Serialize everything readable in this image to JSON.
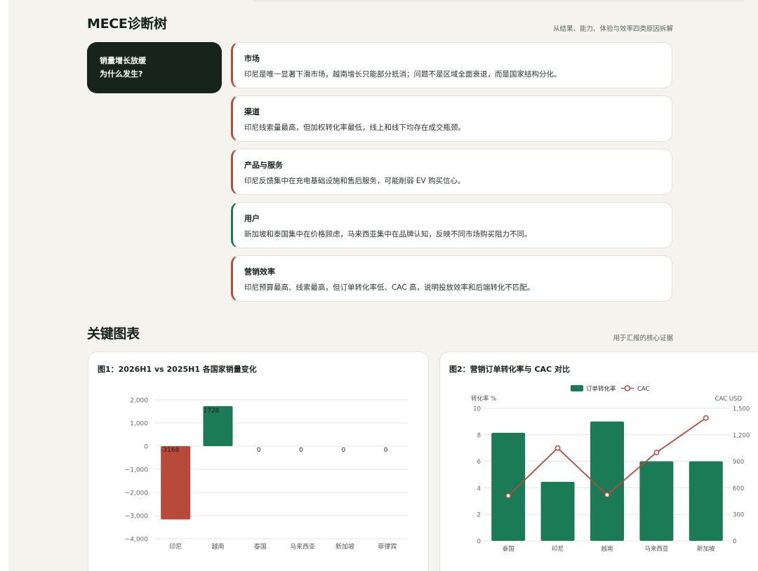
{
  "mece": {
    "title": "MECE诊断树",
    "subtitle": "从结果、能力、体验与效率四类原因拆解",
    "question": [
      "销量增长放缓",
      "为什么发生?"
    ],
    "items": [
      {
        "category": "市场",
        "text": "印尼是唯一显著下滑市场，越南增长只能部分抵消；问题不是区域全面衰退，而是国家结构分化。",
        "status": "negative"
      },
      {
        "category": "渠道",
        "text": "印尼线索量最高，但加权转化率最低，线上和线下均存在成交瓶颈。",
        "status": "negative"
      },
      {
        "category": "产品与服务",
        "text": "印尼反馈集中在充电基础设施和售后服务，可能削弱 EV 购买信心。",
        "status": "negative"
      },
      {
        "category": "用户",
        "text": "新加坡和泰国集中在价格顾虑，马来西亚集中在品牌认知，反映不同市场购买阻力不同。",
        "status": "positive"
      },
      {
        "category": "营销效率",
        "text": "印尼预算最高、线索最高，但订单转化率低、CAC 高，说明投放效率和后端转化不匹配。",
        "status": "negative"
      }
    ]
  },
  "charts_section": {
    "title": "关键图表",
    "subtitle": "用于汇报的核心证据"
  },
  "colors": {
    "negative": "#b84a3a",
    "positive": "#1a7b56",
    "dark": "#17231d",
    "background": "#f4f3ee"
  },
  "chart_data": [
    {
      "type": "bar",
      "title": "图1：2026H1 vs 2025H1 各国家销量变化",
      "categories": [
        "印尼",
        "越南",
        "泰国",
        "马来西亚",
        "新加坡",
        "菲律宾"
      ],
      "values": [
        -3168,
        1728,
        0,
        0,
        0,
        0
      ],
      "value_labels": [
        "-3168",
        "1728",
        "0",
        "0",
        "0",
        "0"
      ],
      "ylim": [
        -4000,
        2000
      ],
      "yticks": [
        2000,
        1000,
        0,
        -1000,
        -2000,
        -3000,
        -4000
      ],
      "ytick_labels": [
        "2,000",
        "1,000",
        "0",
        "−1,000",
        "−2,000",
        "−3,000",
        "−4,000"
      ],
      "grid": true
    },
    {
      "type": "bar+line",
      "title": "图2：营销订单转化率与 CAC 对比",
      "categories": [
        "泰国",
        "印尼",
        "越南",
        "马来西亚",
        "新加坡"
      ],
      "series": [
        {
          "name": "订单转化率",
          "type": "bar",
          "axis": "left",
          "values": [
            8.15,
            4.45,
            9.0,
            6.0,
            6.0
          ]
        },
        {
          "name": "CAC",
          "type": "line",
          "axis": "right",
          "values": [
            510,
            1050,
            520,
            1000,
            1390
          ]
        }
      ],
      "ylabel_left": "转化率 %",
      "ylabel_right": "CAC USD",
      "ylim_left": [
        0,
        10
      ],
      "yticks_left": [
        "0",
        "2",
        "4",
        "6",
        "8",
        "10"
      ],
      "ylim_right": [
        0,
        1500
      ],
      "yticks_right": [
        "0",
        "300",
        "600",
        "900",
        "1,200",
        "1,500"
      ],
      "legend": "top-center",
      "grid": true
    }
  ]
}
